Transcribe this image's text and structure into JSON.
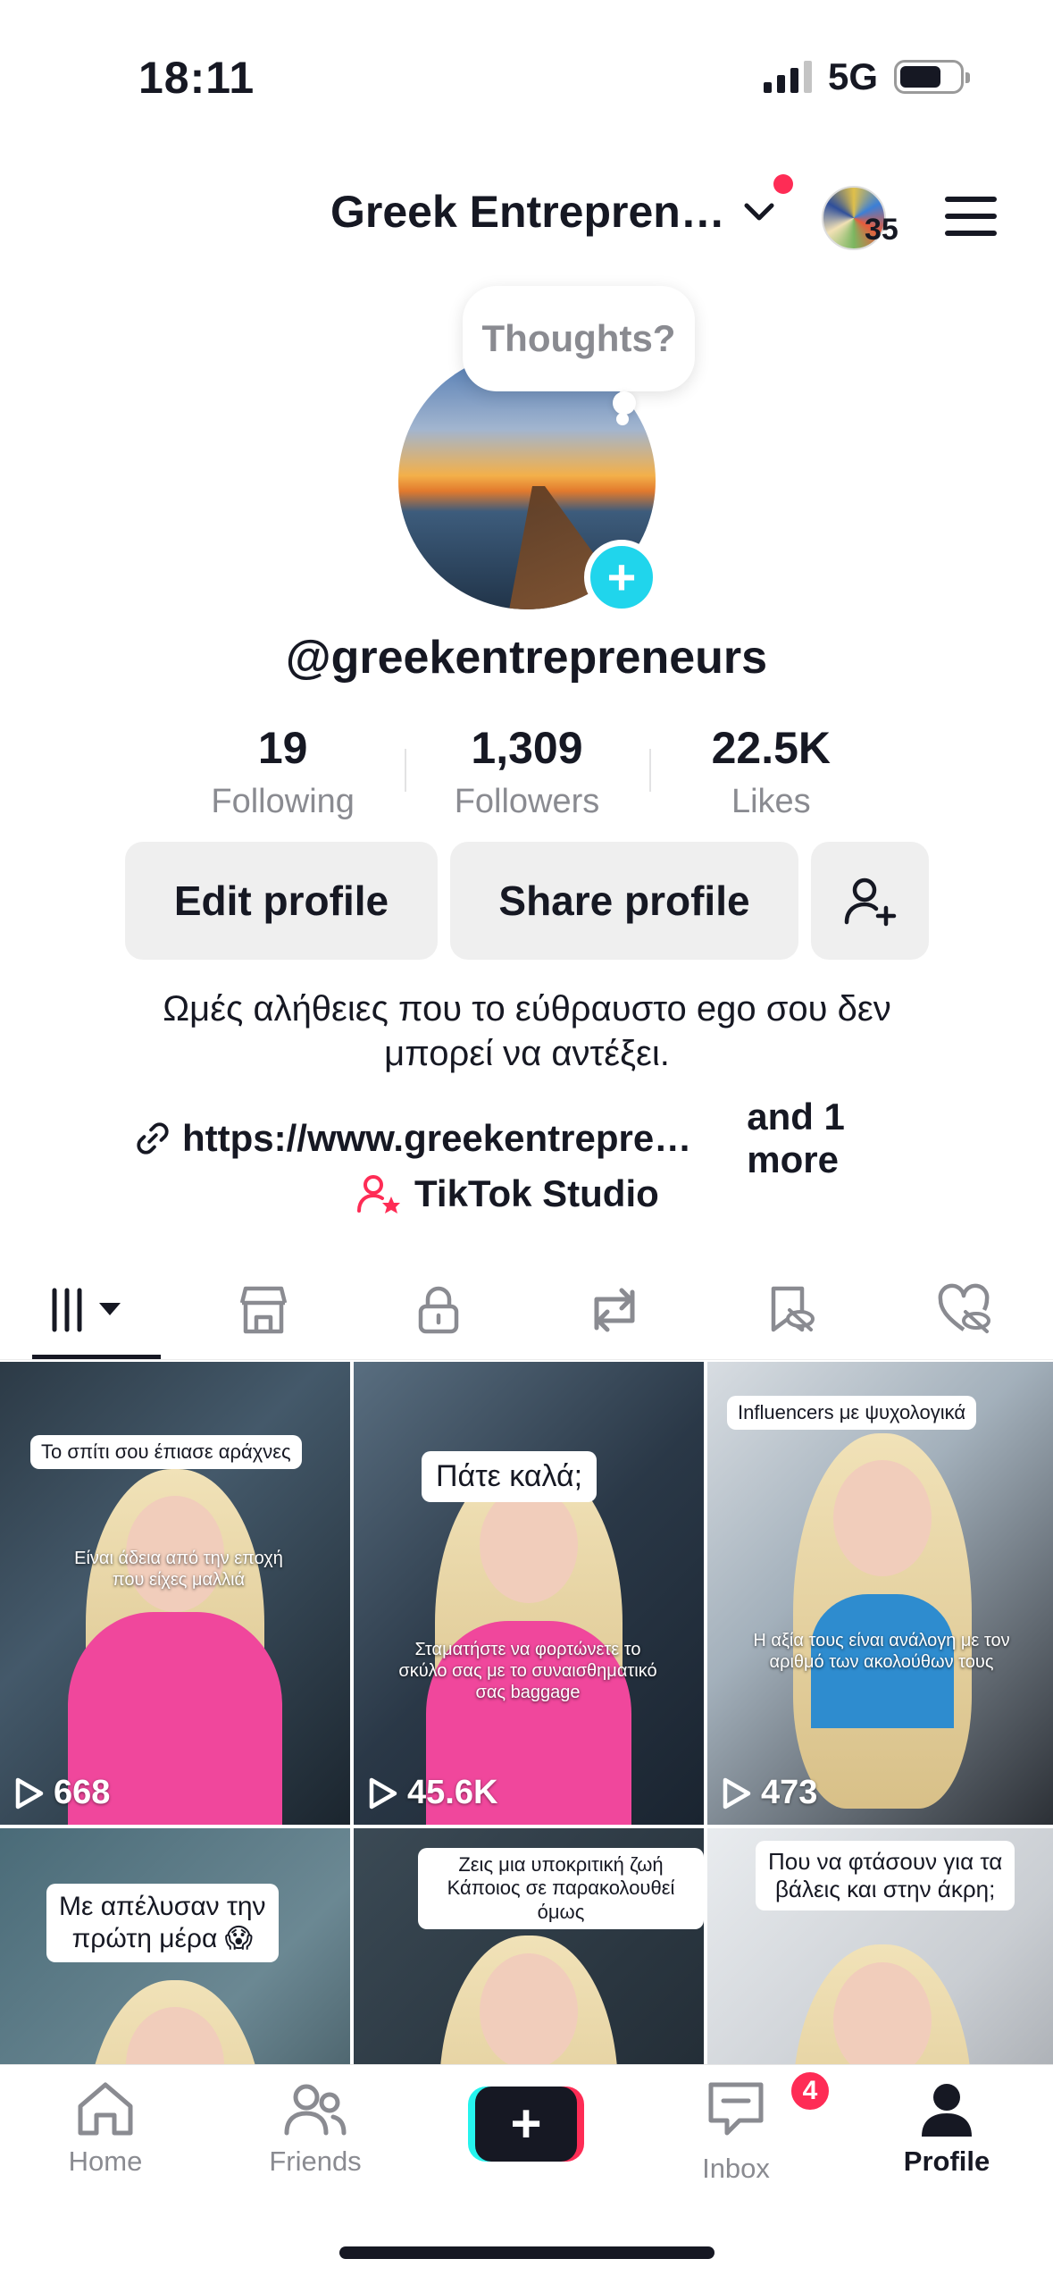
{
  "status_bar": {
    "time": "18:11",
    "network": "5G"
  },
  "header": {
    "account_name": "Greek Entrepren…",
    "avatar_count": "35"
  },
  "profile": {
    "thoughts_placeholder": "Thoughts?",
    "username": "@greekentrepreneurs",
    "stats": [
      {
        "value": "19",
        "label": "Following"
      },
      {
        "value": "1,309",
        "label": "Followers"
      },
      {
        "value": "22.5K",
        "label": "Likes"
      }
    ],
    "buttons": {
      "edit": "Edit profile",
      "share": "Share profile"
    },
    "bio": "Ωμές αλήθειες που το εύθραυστο ego σου δεν\nμπορεί να αντέξει.",
    "link": "https://www.greekentrepre…",
    "link_more": "and 1 more",
    "studio": "TikTok Studio"
  },
  "tabs": [
    "videos-icon",
    "shop-icon",
    "private-icon",
    "reposts-icon",
    "favorites-icon",
    "liked-icon"
  ],
  "videos": [
    {
      "caption": "Το σπίτι σου έπιασε αράχνες",
      "overlay": "Είναι άδεια από την εποχή\nπου είχες μαλλιά",
      "views": "668"
    },
    {
      "caption": "Πάτε καλά;",
      "overlay": "Σταματήστε να φορτώνετε το\nσκύλο σας με το συναισθηματικό\nσας baggage",
      "views": "45.6K"
    },
    {
      "caption": "Influencers με ψυχολογικά",
      "overlay": "Η αξία τους είναι ανάλογη με τον\nαριθμό των ακολούθων τους",
      "views": "473"
    },
    {
      "caption": "Με απέλυσαν την\nπρώτη μέρα 😱",
      "overlay": "",
      "views": ""
    },
    {
      "caption": "Ζεις μια υποκριτική ζωή\nΚάποιος σε παρακολουθεί όμως",
      "overlay": "",
      "views": ""
    },
    {
      "caption": "Που να φτάσουν για τα\nβάλεις και στην άκρη;",
      "overlay": "",
      "views": ""
    }
  ],
  "bottom_nav": {
    "home": "Home",
    "friends": "Friends",
    "inbox": "Inbox",
    "inbox_badge": "4",
    "profile": "Profile"
  },
  "colors": {
    "accent_red": "#fe2c55",
    "accent_cyan": "#25f4ee",
    "add_blue": "#20d5ec"
  }
}
